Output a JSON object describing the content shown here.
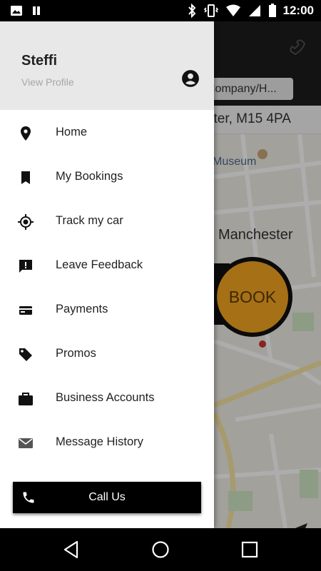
{
  "status_bar": {
    "time": "12:00",
    "icons": [
      "image-icon",
      "pause-icon",
      "bluetooth-icon",
      "vibrate-icon",
      "wifi-icon",
      "battery-icon"
    ]
  },
  "background": {
    "company_chip": "Company/H...",
    "address": "ster, M15 4PA",
    "museum_label": "Museum",
    "city_label": "Manchester",
    "book_label": "BOOK",
    "accent_color": "#f5a623"
  },
  "drawer": {
    "user_name": "Steffi",
    "view_profile": "View Profile",
    "menu": [
      {
        "label": "Home",
        "icon": "location-pin-icon"
      },
      {
        "label": "My Bookings",
        "icon": "bookmark-icon"
      },
      {
        "label": "Track my car",
        "icon": "crosshair-icon"
      },
      {
        "label": "Leave Feedback",
        "icon": "feedback-icon"
      },
      {
        "label": "Payments",
        "icon": "credit-card-icon"
      },
      {
        "label": "Promos",
        "icon": "tag-icon"
      },
      {
        "label": "Business Accounts",
        "icon": "briefcase-icon"
      },
      {
        "label": "Message History",
        "icon": "envelope-icon"
      }
    ],
    "call_button": "Call Us"
  }
}
